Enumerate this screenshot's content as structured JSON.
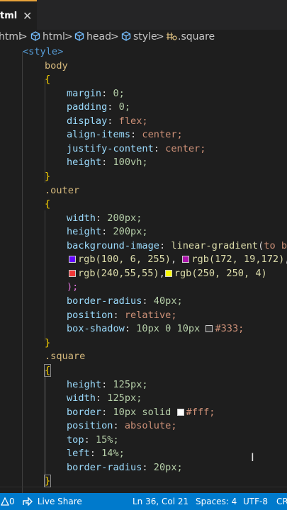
{
  "tab": {
    "label": "tml",
    "close": "✕"
  },
  "breadcrumb": {
    "items": [
      {
        "label": "html",
        "sep": ">"
      },
      {
        "label": "html",
        "sep": ">"
      },
      {
        "label": "head",
        "sep": ">"
      },
      {
        "label": "style",
        "sep": ">"
      },
      {
        "label": ".square",
        "sep": ""
      }
    ]
  },
  "code": {
    "lines": [
      {
        "text": "<style>"
      },
      {
        "text": "body"
      },
      {
        "text": "{"
      },
      {
        "prop": "margin",
        "value": "0;"
      },
      {
        "prop": "padding",
        "value": "0;"
      },
      {
        "prop": "display",
        "value": "flex;"
      },
      {
        "prop": "align-items",
        "value": "center;"
      },
      {
        "prop": "justify-content",
        "value": "center;"
      },
      {
        "prop": "height",
        "value": "100vh;"
      },
      {
        "text": "}"
      },
      {
        "text": ".outer"
      },
      {
        "text": "{"
      },
      {
        "prop": "width",
        "value": "200px;"
      },
      {
        "prop": "height",
        "value": "200px;"
      },
      {
        "prop": "background-image",
        "fn": "linear-gradient",
        "arg": "to bo"
      },
      {
        "c1": "rgb(100, 6, 255)",
        "c2": "rgb(172, 19,172)"
      },
      {
        "c1": "rgb(240,55,55)",
        "c2": "rgb(250, 250, 4)"
      },
      {
        "text": ");"
      },
      {
        "prop": "border-radius",
        "value": "40px;"
      },
      {
        "prop": "position",
        "value": "relative;"
      },
      {
        "prop": "box-shadow",
        "value": "10px 0 10px",
        "color": "#333;"
      },
      {
        "text": "}"
      },
      {
        "text": ".square"
      },
      {
        "text": "{"
      },
      {
        "prop": "height",
        "value": "125px;"
      },
      {
        "prop": "width",
        "value": "125px;"
      },
      {
        "prop": "border",
        "value": "10px solid",
        "color": "#fff;"
      },
      {
        "prop": "position",
        "value": "absolute;"
      },
      {
        "prop": "top",
        "value": "15%;"
      },
      {
        "prop": "left",
        "value": "14%;"
      },
      {
        "prop": "border-radius",
        "value": "20px;"
      },
      {
        "text": "}"
      }
    ]
  },
  "colors": {
    "purple": "#6406ff",
    "magenta": "#ac13ac",
    "red": "#f03737",
    "yellow": "#fafa04",
    "gray": "#333333",
    "white": "#ffffff",
    "statusbar": "#007acc"
  },
  "status": {
    "errors": "0",
    "live_share": "Live Share",
    "position": "Ln 36, Col 21",
    "spaces": "Spaces: 4",
    "encoding": "UTF-8",
    "eol": "CR"
  }
}
